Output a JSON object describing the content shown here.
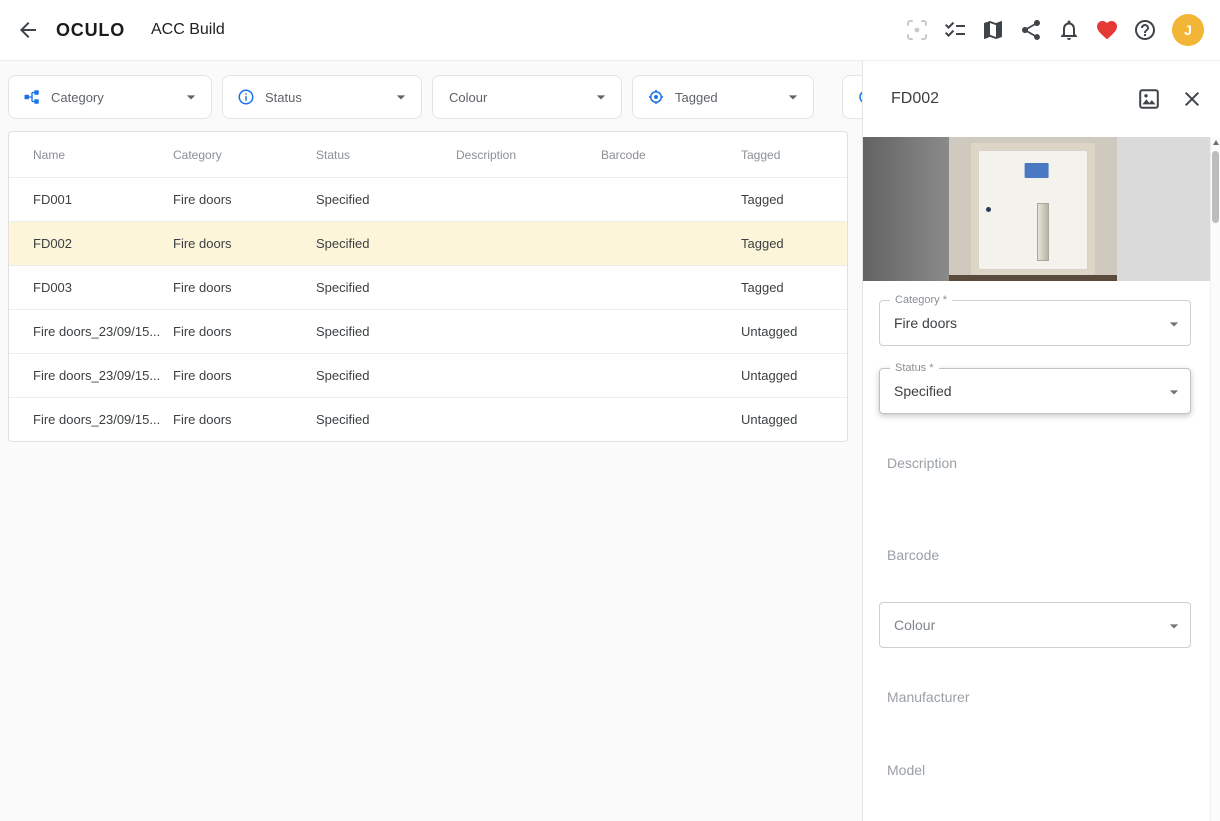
{
  "header": {
    "logo": "OCULO",
    "title": "ACC Build",
    "avatar_initial": "J"
  },
  "filters": {
    "category": "Category",
    "status": "Status",
    "colour": "Colour",
    "tagged": "Tagged"
  },
  "table": {
    "columns": [
      "Name",
      "Category",
      "Status",
      "Description",
      "Barcode",
      "Tagged"
    ],
    "rows": [
      {
        "name": "FD001",
        "category": "Fire doors",
        "status": "Specified",
        "description": "",
        "barcode": "",
        "tagged": "Tagged"
      },
      {
        "name": "FD002",
        "category": "Fire doors",
        "status": "Specified",
        "description": "",
        "barcode": "",
        "tagged": "Tagged"
      },
      {
        "name": "FD003",
        "category": "Fire doors",
        "status": "Specified",
        "description": "",
        "barcode": "",
        "tagged": "Tagged"
      },
      {
        "name": "Fire doors_23/09/15...",
        "category": "Fire doors",
        "status": "Specified",
        "description": "",
        "barcode": "",
        "tagged": "Untagged"
      },
      {
        "name": "Fire doors_23/09/15...",
        "category": "Fire doors",
        "status": "Specified",
        "description": "",
        "barcode": "",
        "tagged": "Untagged"
      },
      {
        "name": "Fire doors_23/09/15...",
        "category": "Fire doors",
        "status": "Specified",
        "description": "",
        "barcode": "",
        "tagged": "Untagged"
      }
    ],
    "selected_row_name": "FD002"
  },
  "panel": {
    "title": "FD002",
    "fields": {
      "category": {
        "label": "Category *",
        "value": "Fire doors"
      },
      "status": {
        "label": "Status *",
        "value": "Specified"
      },
      "description": {
        "label": "Description",
        "value": ""
      },
      "barcode": {
        "label": "Barcode",
        "value": ""
      },
      "colour": {
        "label": "Colour",
        "value": ""
      },
      "manufacturer": {
        "label": "Manufacturer",
        "value": ""
      },
      "model": {
        "label": "Model",
        "value": ""
      }
    }
  },
  "colors": {
    "accent_blue": "#1a73e8",
    "heart_red": "#e53935",
    "avatar_gold": "#f2b535",
    "selected_row": "#fdf5da"
  }
}
